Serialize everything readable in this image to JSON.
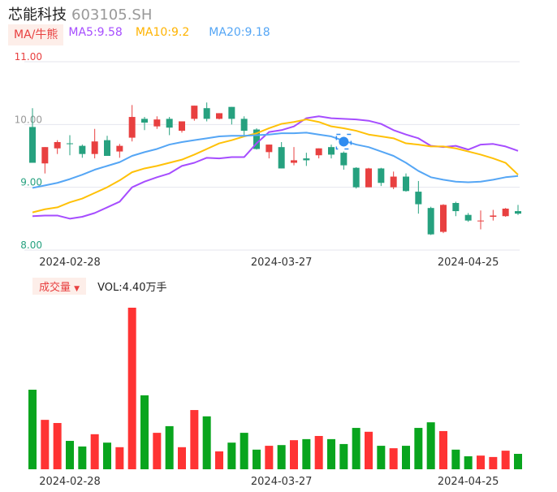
{
  "header": {
    "name": "芯能科技",
    "code": "603105.SH"
  },
  "legend": {
    "ma_label": "MA/牛熊",
    "ma5": "MA5:9.58",
    "ma10": "MA10:9.2",
    "ma20": "MA20:9.18"
  },
  "volume_header": {
    "label": "成交量",
    "arrow": "▼",
    "value": "VOL:4.40万手"
  },
  "colors": {
    "up": "#e84040",
    "down": "#26a17f",
    "vol_up": "#ff3333",
    "vol_down": "#09a51e",
    "ma5": "#a64dff",
    "ma10": "#ffc107",
    "ma20": "#55a6f5"
  },
  "chart_data": {
    "type": "candlestick",
    "title": "芯能科技 603105.SH",
    "y_ticks": [
      "11.00",
      "10.00",
      "9.00",
      "8.00"
    ],
    "ylim": [
      8,
      11
    ],
    "x_labels": [
      "2024-02-28",
      "2024-03-27",
      "2024-04-25"
    ],
    "x_label_index": [
      0,
      17,
      32
    ],
    "ohlc": [
      [
        9.96,
        10.26,
        9.39,
        9.39
      ],
      [
        9.38,
        9.64,
        9.22,
        9.64
      ],
      [
        9.62,
        9.75,
        9.53,
        9.72
      ],
      [
        9.7,
        9.83,
        9.51,
        9.7
      ],
      [
        9.66,
        9.68,
        9.47,
        9.53
      ],
      [
        9.53,
        9.93,
        9.46,
        9.73
      ],
      [
        9.75,
        9.82,
        9.5,
        9.5
      ],
      [
        9.57,
        9.69,
        9.47,
        9.66
      ],
      [
        9.79,
        10.31,
        9.73,
        10.12
      ],
      [
        10.09,
        10.12,
        9.91,
        10.03
      ],
      [
        9.97,
        10.13,
        9.93,
        10.08
      ],
      [
        10.09,
        10.12,
        9.83,
        9.95
      ],
      [
        9.9,
        10.05,
        9.87,
        10.05
      ],
      [
        10.09,
        10.3,
        10.06,
        10.3
      ],
      [
        10.26,
        10.35,
        10.05,
        10.09
      ],
      [
        10.09,
        10.18,
        10.08,
        10.18
      ],
      [
        10.28,
        10.28,
        10.0,
        10.09
      ],
      [
        10.09,
        10.13,
        9.83,
        9.9
      ],
      [
        9.92,
        9.94,
        9.6,
        9.61
      ],
      [
        9.56,
        9.68,
        9.46,
        9.68
      ],
      [
        9.64,
        9.72,
        9.3,
        9.3
      ],
      [
        9.39,
        9.64,
        9.35,
        9.43
      ],
      [
        9.46,
        9.55,
        9.34,
        9.43
      ],
      [
        9.51,
        9.62,
        9.46,
        9.62
      ],
      [
        9.64,
        9.68,
        9.46,
        9.52
      ],
      [
        9.55,
        9.57,
        9.28,
        9.35
      ],
      [
        9.31,
        9.32,
        8.98,
        9.0
      ],
      [
        9.0,
        9.31,
        9.0,
        9.3
      ],
      [
        9.3,
        9.31,
        9.02,
        9.07
      ],
      [
        9.0,
        9.25,
        8.97,
        9.17
      ],
      [
        9.17,
        9.22,
        8.93,
        8.94
      ],
      [
        8.93,
        9.1,
        8.58,
        8.73
      ],
      [
        8.67,
        8.69,
        8.24,
        8.25
      ],
      [
        8.29,
        8.73,
        8.27,
        8.72
      ],
      [
        8.75,
        8.77,
        8.54,
        8.62
      ],
      [
        8.56,
        8.59,
        8.45,
        8.47
      ],
      [
        8.46,
        8.63,
        8.33,
        8.47
      ],
      [
        8.53,
        8.64,
        8.47,
        8.55
      ],
      [
        8.54,
        8.67,
        8.53,
        8.66
      ],
      [
        8.62,
        8.72,
        8.56,
        8.58
      ]
    ],
    "ma5": [
      8.54,
      8.55,
      8.55,
      8.5,
      8.53,
      8.59,
      8.68,
      8.77,
      9.0,
      9.09,
      9.16,
      9.22,
      9.34,
      9.39,
      9.47,
      9.46,
      9.48,
      9.48,
      9.7,
      9.88,
      9.91,
      9.97,
      10.1,
      10.13,
      10.1,
      10.09,
      10.08,
      10.06,
      10.01,
      9.91,
      9.84,
      9.78,
      9.66,
      9.64,
      9.66,
      9.6,
      9.68,
      9.69,
      9.65,
      9.58
    ],
    "ma10": [
      8.6,
      8.65,
      8.68,
      8.76,
      8.82,
      8.91,
      9.0,
      9.11,
      9.24,
      9.3,
      9.34,
      9.39,
      9.44,
      9.52,
      9.61,
      9.7,
      9.75,
      9.81,
      9.86,
      9.94,
      10.01,
      10.04,
      10.08,
      10.04,
      9.97,
      9.94,
      9.9,
      9.84,
      9.81,
      9.78,
      9.7,
      9.68,
      9.65,
      9.65,
      9.62,
      9.57,
      9.52,
      9.46,
      9.39,
      9.2
    ],
    "ma20": [
      8.99,
      9.03,
      9.07,
      9.13,
      9.2,
      9.28,
      9.34,
      9.4,
      9.5,
      9.56,
      9.61,
      9.68,
      9.72,
      9.75,
      9.78,
      9.81,
      9.82,
      9.82,
      9.83,
      9.84,
      9.86,
      9.86,
      9.87,
      9.84,
      9.81,
      9.74,
      9.68,
      9.64,
      9.57,
      9.5,
      9.39,
      9.26,
      9.16,
      9.12,
      9.09,
      9.08,
      9.09,
      9.12,
      9.16,
      9.18
    ],
    "volume_wan": [
      22.7,
      14.1,
      13.2,
      8.1,
      6.5,
      10.0,
      7.6,
      6.3,
      46.1,
      21.1,
      10.4,
      12.3,
      6.3,
      16.9,
      15.1,
      5.1,
      7.6,
      10.4,
      5.6,
      6.7,
      6.9,
      8.3,
      8.6,
      9.5,
      8.6,
      7.2,
      11.8,
      10.7,
      6.7,
      6.0,
      6.7,
      11.8,
      13.4,
      10.9,
      5.6,
      3.7,
      3.9,
      3.5,
      5.3,
      4.4
    ],
    "highlight_index": 25
  }
}
